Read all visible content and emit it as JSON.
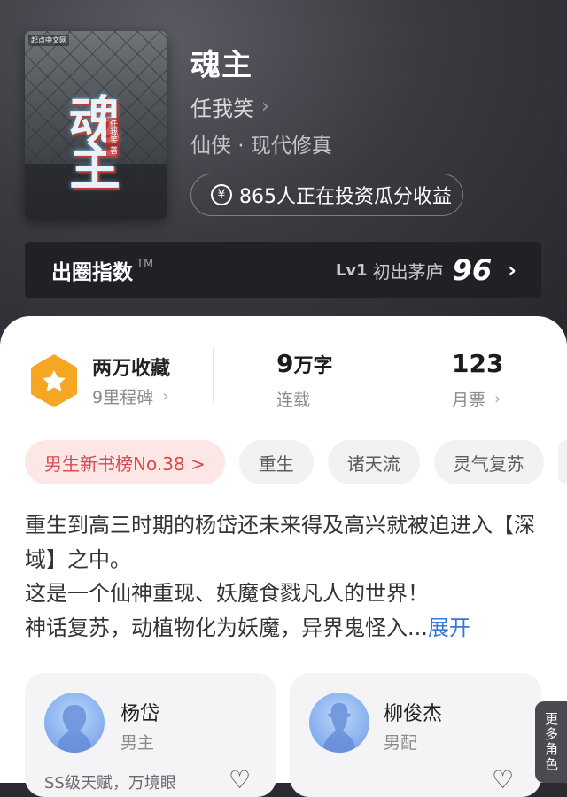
{
  "book": {
    "title": "魂主",
    "author": "任我笑",
    "genre": "仙侠 · 现代修真",
    "cover_badge": "起点中文网",
    "cover_title": "魂主",
    "cover_author": "任我笑 著",
    "invest_text": "865人正在投资瓜分收益"
  },
  "breakout": {
    "label": "出圈指数",
    "tm": "TM",
    "level": "Lv1",
    "stage": "初出茅庐",
    "score": "96"
  },
  "stats": {
    "favorites": "两万收藏",
    "milestones": "9里程碑",
    "words_num": "9",
    "words_unit": "万字",
    "status": "连载",
    "tickets": "123",
    "tickets_label": "月票"
  },
  "tags": [
    "男生新书榜No.38 >",
    "重生",
    "诸天流",
    "灵气复苏"
  ],
  "synopsis": {
    "line1": "重生到高三时期的杨岱还未来得及高兴就被迫进入【深域】之中。",
    "line2": "这是一个仙神重现、妖魔食戮凡人的世界！",
    "line3": "神话复苏，动植物化为妖魔，异界鬼怪入...",
    "expand": "展开"
  },
  "characters": [
    {
      "name": "杨岱",
      "role": "男主",
      "desc": "SS级天赋，万境眼"
    },
    {
      "name": "柳俊杰",
      "role": "男配",
      "desc": ""
    }
  ],
  "more_roles": "更多角色",
  "colors": {
    "accent_blue": "#3a78d8",
    "rank_red": "#d94b4b",
    "badge_orange": "#f5a623"
  }
}
